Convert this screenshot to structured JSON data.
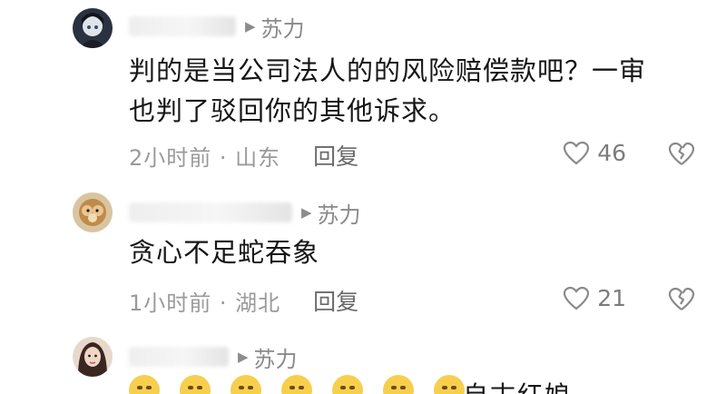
{
  "comments": [
    {
      "author": "苏力",
      "text_lines": [
        "判的是当公司法人的的风险赔偿款吧？一审",
        "也判了驳回你的其他诉求。"
      ],
      "time_location": "2小时前 · 山东",
      "reply_label": "回复",
      "likes": "46",
      "avatar_colors": [
        "#1d2230",
        "#6a7486"
      ]
    },
    {
      "author": "苏力",
      "text_lines": [
        "贪心不足蛇吞象"
      ],
      "time_location": "1小时前 · 湖北",
      "reply_label": "回复",
      "likes": "21",
      "avatar_colors": [
        "#b07a3a",
        "#e0b98a"
      ]
    },
    {
      "author": "苏力",
      "text_partial": "自古红娘",
      "avatar_colors": [
        "#5a3a30",
        "#d8b8a8"
      ],
      "emoji_count": 7
    }
  ],
  "icons": {
    "reply_arrow": "reply-arrow-icon",
    "like": "heart-outline-icon",
    "dislike": "broken-heart-icon"
  },
  "colors": {
    "text": "#161616",
    "meta": "#9a9a9a",
    "icon": "#8c8c8c"
  }
}
